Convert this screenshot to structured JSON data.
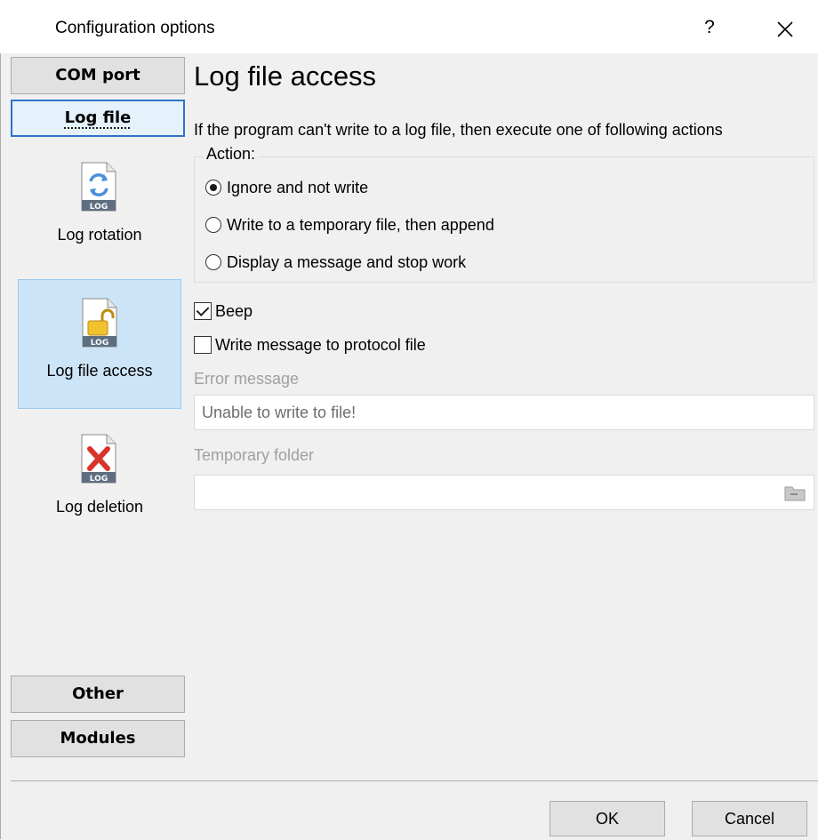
{
  "window": {
    "title": "Configuration options",
    "help_label": "?",
    "close_icon": "close-icon"
  },
  "sidebar": {
    "top_buttons": [
      {
        "label": "COM port",
        "active": false
      },
      {
        "label": "Log file",
        "active": true
      }
    ],
    "items": [
      {
        "label": "Log rotation",
        "icon": "log-rotation-icon",
        "badge": "LOG",
        "selected": false
      },
      {
        "label": "Log file access",
        "icon": "log-access-lock-icon",
        "badge": "LOG",
        "selected": true
      },
      {
        "label": "Log deletion",
        "icon": "log-deletion-icon",
        "badge": "LOG",
        "selected": false
      }
    ],
    "bottom_buttons": [
      {
        "label": "Other"
      },
      {
        "label": "Modules"
      }
    ]
  },
  "main": {
    "heading": "Log file access",
    "intro": "If the program can't write to a log file, then execute one of following actions",
    "action_group": {
      "title": "Action:",
      "options": [
        {
          "label": "Ignore and not write",
          "checked": true
        },
        {
          "label": "Write to a temporary file, then append",
          "checked": false
        },
        {
          "label": "Display a message and stop work",
          "checked": false
        }
      ]
    },
    "beep": {
      "label": "Beep",
      "checked": true
    },
    "write_protocol": {
      "label": "Write message to protocol file",
      "checked": false
    },
    "error_message": {
      "label": "Error message",
      "value": "Unable to write to file!"
    },
    "temp_folder": {
      "label": "Temporary folder",
      "value": "",
      "browse_icon": "folder-icon"
    }
  },
  "footer": {
    "ok_label": "OK",
    "cancel_label": "Cancel"
  },
  "colors": {
    "accent": "#2e72c9",
    "selected_bg": "#cce4f7",
    "disabled_text": "#a0a0a0"
  }
}
